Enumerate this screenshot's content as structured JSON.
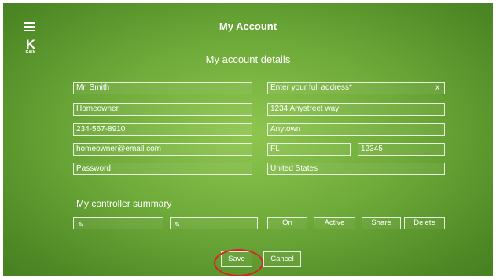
{
  "header": {
    "title": "My Account",
    "subtitle": "My account details"
  },
  "logo": {
    "letter": "K",
    "small": "RAIN"
  },
  "left_fields": [
    {
      "value": "Mr. Smith"
    },
    {
      "value": "Homeowner"
    },
    {
      "value": "234-567-8910"
    },
    {
      "value": "homeowner@email.com"
    },
    {
      "value": "Password"
    }
  ],
  "right_fields": {
    "address_placeholder": "Enter your full address*",
    "address_clear": "x",
    "street": "1234 Anystreet way",
    "city": "Anytown",
    "state": "FL",
    "zip": "12345",
    "country": "United States"
  },
  "controller": {
    "heading": "My controller summary",
    "pencil_glyph": "✎",
    "buttons": {
      "on": "On",
      "active": "Active",
      "share": "Share",
      "delete": "Delete"
    }
  },
  "footer": {
    "save": "Save",
    "cancel": "Cancel"
  },
  "colors": {
    "accent_ring": "#dd2222",
    "background": "#6fab3a"
  }
}
